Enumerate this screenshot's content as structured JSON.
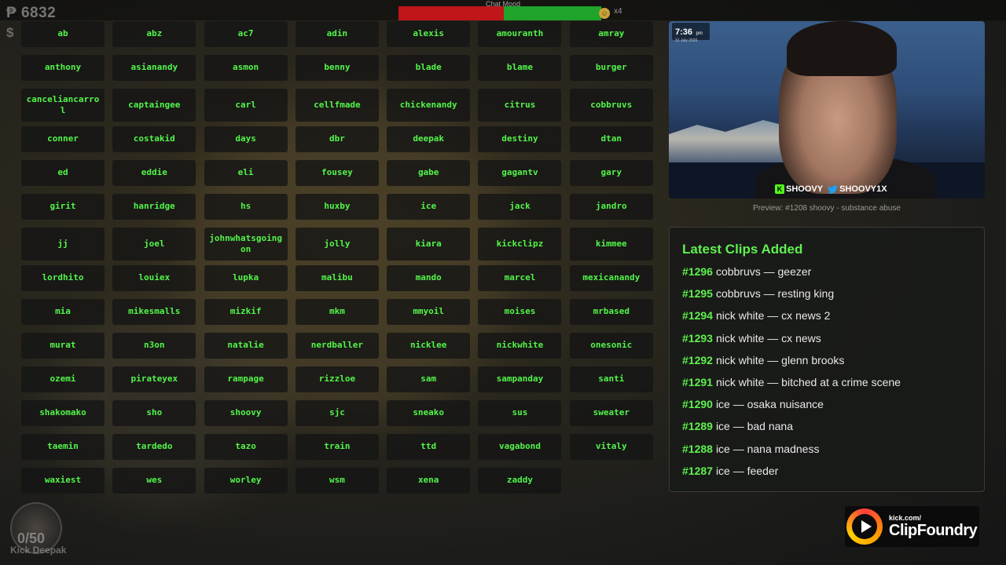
{
  "hud": {
    "points": "₱ 6832",
    "dollar": "$",
    "mood_label": "Chat Mood",
    "mood_positive_fraction": 0.48,
    "mood_multiplier": "x4",
    "mood_emoji": "☺"
  },
  "grid_items": [
    "ab",
    "abz",
    "ac7",
    "adin",
    "alexis",
    "amouranth",
    "amray",
    "anthony",
    "asianandy",
    "asmon",
    "benny",
    "blade",
    "blame",
    "burger",
    "canceliancarrol",
    "captaingee",
    "carl",
    "cellfmade",
    "chickenandy",
    "citrus",
    "cobbruvs",
    "conner",
    "costakid",
    "days",
    "dbr",
    "deepak",
    "destiny",
    "dtan",
    "ed",
    "eddie",
    "eli",
    "fousey",
    "gabe",
    "gagantv",
    "gary",
    "girit",
    "hanridge",
    "hs",
    "huxby",
    "ice",
    "jack",
    "jandro",
    "jj",
    "joel",
    "johnwhatsgoingon",
    "jolly",
    "kiara",
    "kickclipz",
    "kimmee",
    "lordhito",
    "louiex",
    "lupka",
    "malibu",
    "mando",
    "marcel",
    "mexicanandy",
    "mia",
    "mikesmalls",
    "mizkif",
    "mkm",
    "mmyoil",
    "moises",
    "mrbased",
    "murat",
    "n3on",
    "natalie",
    "nerdballer",
    "nicklee",
    "nickwhite",
    "onesonic",
    "ozemi",
    "pirateyex",
    "rampage",
    "rizzloe",
    "sam",
    "sampanday",
    "santi",
    "shakomako",
    "sho",
    "shoovy",
    "sjc",
    "sneako",
    "sus",
    "sweater",
    "taemin",
    "tardedo",
    "tazo",
    "train",
    "ttd",
    "vagabond",
    "vitaly",
    "waxiest",
    "wes",
    "worley",
    "wsm",
    "xena",
    "zaddy"
  ],
  "video": {
    "clock_time": "7:36",
    "clock_ampm": "pm",
    "clock_date": "31 July 2026",
    "kick_handle": "SHOOVY",
    "twitter_handle": "SHOOVY1X",
    "kick_badge": "K",
    "caption": "Preview: #1208 shoovy - substance abuse"
  },
  "clips": {
    "title": "Latest Clips Added",
    "items": [
      {
        "num": "#1296",
        "text": "cobbruvs — geezer"
      },
      {
        "num": "#1295",
        "text": "cobbruvs — resting king"
      },
      {
        "num": "#1294",
        "text": "nick white — cx news 2"
      },
      {
        "num": "#1293",
        "text": "nick white — cx news"
      },
      {
        "num": "#1292",
        "text": "nick white — glenn brooks"
      },
      {
        "num": "#1291",
        "text": "nick white — bitched at a crime scene"
      },
      {
        "num": "#1290",
        "text": "ice — osaka nuisance"
      },
      {
        "num": "#1289",
        "text": "ice — bad nana"
      },
      {
        "num": "#1288",
        "text": "ice — nana madness"
      },
      {
        "num": "#1287",
        "text": "ice — feeder"
      }
    ]
  },
  "footer": {
    "counter": "0/50",
    "kick_name": "Kick Deepak",
    "brand_url": "kick.com/",
    "brand_name": "ClipFoundry"
  },
  "colors": {
    "accent_green": "#52f54a",
    "mood_negative": "#c0161a",
    "mood_positive": "#1fa32a"
  }
}
